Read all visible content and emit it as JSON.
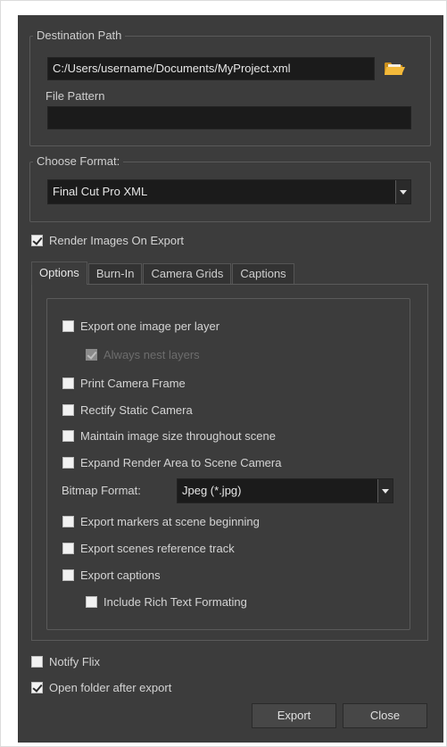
{
  "destination": {
    "group_title": "Destination Path",
    "path_value": "C:/Users/username/Documents/MyProject.xml",
    "pattern_label": "File Pattern",
    "pattern_value": ""
  },
  "format": {
    "group_title": "Choose Format:",
    "selected": "Final Cut Pro XML"
  },
  "render_images": {
    "label": "Render Images On Export",
    "checked": true
  },
  "tabs": [
    {
      "label": "Options",
      "active": true
    },
    {
      "label": "Burn-In",
      "active": false
    },
    {
      "label": "Camera Grids",
      "active": false
    },
    {
      "label": "Captions",
      "active": false
    }
  ],
  "options": {
    "export_one_image": {
      "label": "Export one image per layer",
      "checked": false
    },
    "always_nest": {
      "label": "Always nest layers",
      "checked": true,
      "disabled": true
    },
    "print_camera_frame": {
      "label": "Print Camera Frame",
      "checked": false
    },
    "rectify_static": {
      "label": "Rectify Static Camera",
      "checked": false
    },
    "maintain_size": {
      "label": "Maintain image size throughout scene",
      "checked": false
    },
    "expand_render": {
      "label": "Expand Render Area to Scene Camera",
      "checked": false
    },
    "bitmap_label": "Bitmap Format:",
    "bitmap_value": "Jpeg (*.jpg)",
    "export_markers": {
      "label": "Export markers at scene beginning",
      "checked": false
    },
    "export_ref_track": {
      "label": "Export scenes reference track",
      "checked": false
    },
    "export_captions": {
      "label": "Export captions",
      "checked": false
    },
    "rich_text": {
      "label": "Include Rich Text Formating",
      "checked": false
    }
  },
  "notify_flix": {
    "label": "Notify Flix",
    "checked": false
  },
  "open_folder": {
    "label": "Open folder after export",
    "checked": true
  },
  "buttons": {
    "export": "Export",
    "close": "Close"
  },
  "icons": {
    "browse": "folder-icon"
  },
  "colors": {
    "dialog_bg": "#3c3c3c",
    "field_bg": "#1b1b1b",
    "folder": "#f0b330"
  }
}
